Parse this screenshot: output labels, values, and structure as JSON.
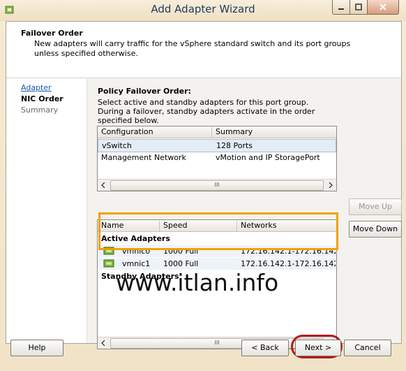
{
  "window": {
    "title": "Add Adapter Wizard"
  },
  "header": {
    "title": "Failover Order",
    "description": "New adapters will carry traffic for the vSphere standard switch and its port groups unless specified otherwise."
  },
  "nav": {
    "items": [
      "Adapter",
      "NIC Order",
      "Summary"
    ]
  },
  "section": {
    "title": "Policy Failover Order:",
    "description": "Select active and standby adapters for this port group. During a failover, standby adapters activate in the order specified below."
  },
  "portgroups_table": {
    "columns": [
      "Configuration",
      "Summary"
    ],
    "rows": [
      {
        "configuration": "vSwitch",
        "summary": "128 Ports"
      },
      {
        "configuration": "Management Network",
        "summary": "vMotion and IP StoragePort"
      }
    ],
    "scroll_thumb": "III"
  },
  "adapters_table": {
    "columns": [
      "Name",
      "Speed",
      "Networks"
    ],
    "active_label": "Active Adapters",
    "standby_label": "Standby Adapters",
    "active": [
      {
        "name": "vmnic0",
        "speed": "1000 Full",
        "networks": "172.16.142.1-172.16.142..."
      },
      {
        "name": "vmnic1",
        "speed": "1000 Full",
        "networks": "172.16.142.1-172.16.142..."
      }
    ],
    "scroll_thumb": "III"
  },
  "side_buttons": {
    "move_up": "Move Up",
    "move_down": "Move Down"
  },
  "footer": {
    "help": "Help",
    "back": "< Back",
    "next": "Next >",
    "cancel": "Cancel"
  },
  "watermark": "www.itlan.info",
  "colors": {
    "highlight_box": "#f2a100",
    "next_ring": "#b01c1c",
    "link": "#1a55b0"
  }
}
